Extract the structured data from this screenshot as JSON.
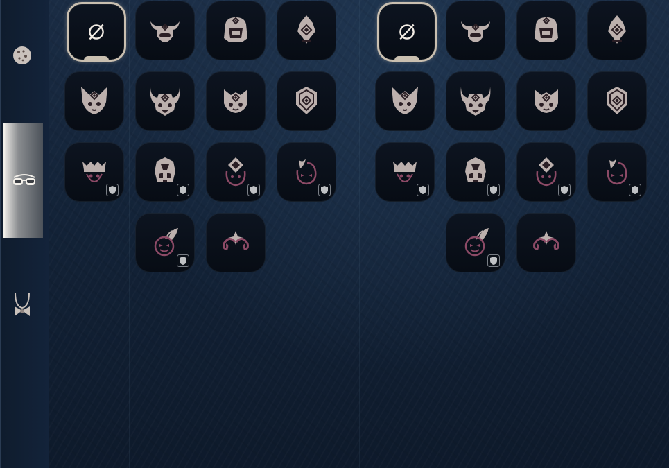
{
  "colors": {
    "icon_fill": "#bcb0ad",
    "icon_mark": "#2a1e24",
    "accent_pink": "#8c4a66",
    "selected_border": "#c9bfb0",
    "tile_bg": "#0a111b"
  },
  "sidebar": {
    "categories": [
      {
        "icon": "cookie-icon",
        "active": false
      },
      {
        "icon": "sunglasses-icon",
        "active": true
      },
      {
        "icon": "bowtie-necklace-icon",
        "active": false
      }
    ]
  },
  "panels": [
    {
      "rows": [
        [
          {
            "icon": "none-icon",
            "selected": true
          },
          {
            "icon": "ox-mask-icon"
          },
          {
            "icon": "helmet-mask-icon"
          },
          {
            "icon": "crest-mask-icon"
          }
        ],
        [
          {
            "icon": "fox-mask-icon"
          },
          {
            "icon": "horned-mask-icon"
          },
          {
            "icon": "cat-mask-icon"
          },
          {
            "icon": "shield-mask-icon"
          }
        ],
        [
          {
            "icon": "crown-face-icon",
            "locked": true
          },
          {
            "icon": "robot-face-icon",
            "locked": true
          },
          {
            "icon": "diamond-face-icon",
            "locked": true
          },
          {
            "icon": "flame-face-icon",
            "locked": true
          }
        ],
        [
          null,
          {
            "icon": "feather-face-icon",
            "locked": true
          },
          {
            "icon": "mustache-icon"
          },
          null
        ]
      ]
    },
    {
      "rows": [
        [
          {
            "icon": "none-icon",
            "selected": true
          },
          {
            "icon": "ox-mask-icon"
          },
          {
            "icon": "helmet-mask-icon"
          },
          {
            "icon": "crest-mask-icon"
          }
        ],
        [
          {
            "icon": "fox-mask-icon"
          },
          {
            "icon": "horned-mask-icon"
          },
          {
            "icon": "cat-mask-icon"
          },
          {
            "icon": "shield-mask-icon"
          }
        ],
        [
          {
            "icon": "crown-face-icon",
            "locked": true
          },
          {
            "icon": "robot-face-icon",
            "locked": true
          },
          {
            "icon": "diamond-face-icon",
            "locked": true
          },
          {
            "icon": "flame-face-icon",
            "locked": true
          }
        ],
        [
          null,
          {
            "icon": "feather-face-icon",
            "locked": true
          },
          {
            "icon": "mustache-icon"
          },
          null
        ]
      ]
    }
  ]
}
